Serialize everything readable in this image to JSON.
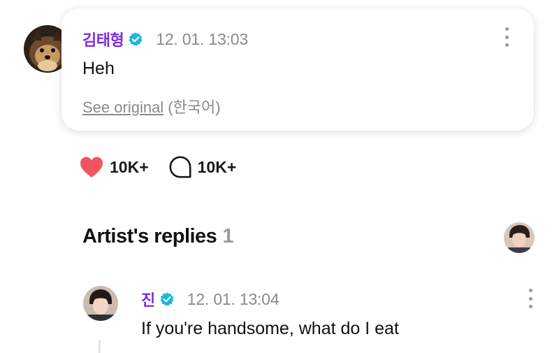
{
  "comment": {
    "author": "김태형",
    "timestamp": "12. 01. 13:03",
    "text": "Heh",
    "see_original": "See original",
    "original_language": "(한국어)",
    "verified_icon": "verified-badge-icon",
    "avatar_icon": "avatar-dog"
  },
  "reactions": {
    "likes": "10K+",
    "comments": "10K+"
  },
  "artist_replies": {
    "title": "Artist's replies",
    "count": "1"
  },
  "reply": {
    "author": "진",
    "timestamp": "12. 01. 13:04",
    "text": "If you're handsome, what do I eat"
  },
  "colors": {
    "author": "#7b2cdc",
    "verified": "#1bb8d8",
    "heart": "#f0555f",
    "muted": "#8a8a8a"
  }
}
